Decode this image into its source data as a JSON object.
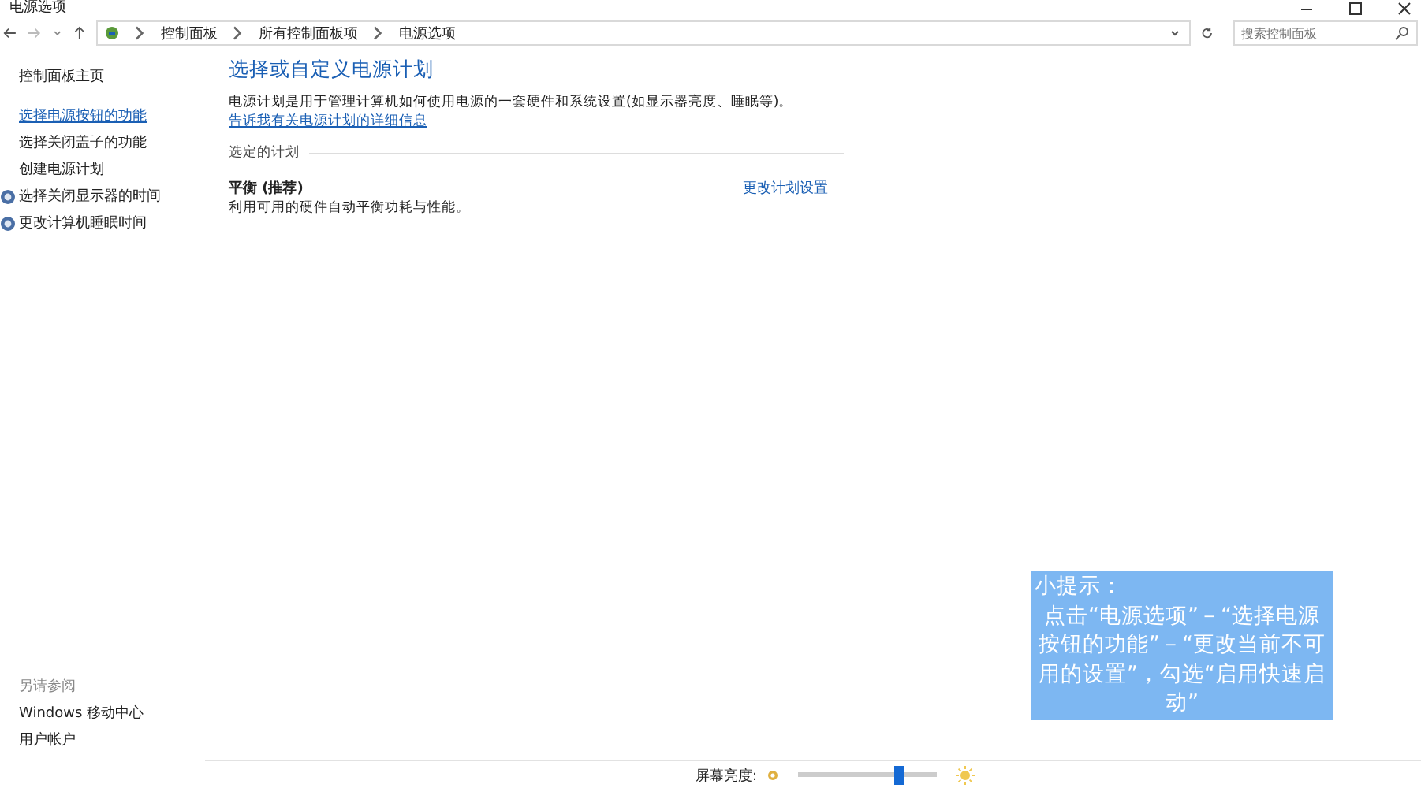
{
  "window": {
    "title": "电源选项"
  },
  "address_bar": {
    "crumbs": [
      "控制面板",
      "所有控制面板项",
      "电源选项"
    ]
  },
  "search": {
    "placeholder": "搜索控制面板"
  },
  "sidebar": {
    "items": [
      {
        "label": "控制面板主页",
        "kind": "plain"
      },
      {
        "label": "选择电源按钮的功能",
        "kind": "link"
      },
      {
        "label": "选择关闭盖子的功能",
        "kind": "plain"
      },
      {
        "label": "创建电源计划",
        "kind": "plain"
      },
      {
        "label": "选择关闭显示器的时间",
        "kind": "icon"
      },
      {
        "label": "更改计算机睡眠时间",
        "kind": "icon"
      }
    ],
    "see_also": {
      "heading": "另请参阅",
      "items": [
        "Windows 移动中心",
        "用户帐户"
      ]
    }
  },
  "content": {
    "heading": "选择或自定义电源计划",
    "description": "电源计划是用于管理计算机如何使用电源的一套硬件和系统设置(如显示器亮度、睡眠等)。",
    "description_link": "告诉我有关电源计划的详细信息",
    "section": "选定的计划",
    "plans": [
      {
        "name": "平衡 (推荐)",
        "detail": "利用可用的硬件自动平衡功耗与性能。",
        "action": "更改计划设置"
      }
    ]
  },
  "brightness": {
    "label": "屏幕亮度:",
    "level": 0.73
  },
  "tip": {
    "title": "小提示：",
    "body": "点击“电源选项”－“选择电源按钮的功能”－“更改当前不可用的设置”，勾选“启用快速启动”"
  }
}
